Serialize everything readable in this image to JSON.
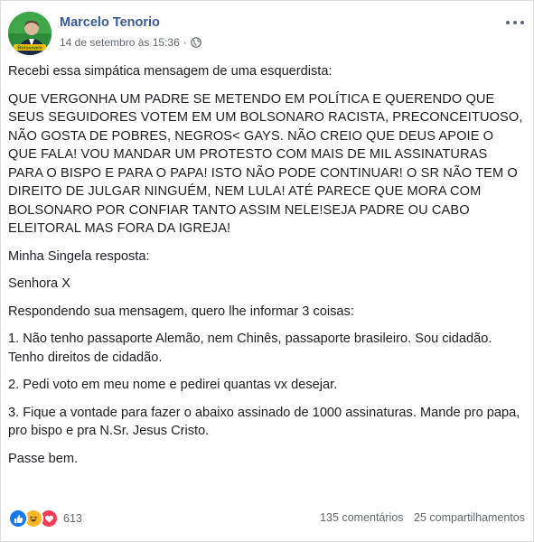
{
  "post": {
    "author": "Marcelo Tenorio",
    "timestamp": "14 de setembro às 15:36",
    "privacy_icon": "globe-icon",
    "avatar_label": "Bolsonaro",
    "menu_icon": "more-options-icon",
    "paragraphs": [
      "Recebi essa simpática mensagem de uma esquerdista:",
      "QUE VERGONHA UM PADRE SE METENDO EM POLÍTICA E QUERENDO QUE SEUS SEGUIDORES VOTEM EM UM BOLSONARO RACISTA, PRECONCEITUOSO, NÃO GOSTA DE POBRES, NEGROS< GAYS. NÃO CREIO QUE DEUS APOIE O QUE FALA! VOU MANDAR UM PROTESTO COM MAIS DE MIL ASSINATURAS PARA O BISPO E PARA O PAPA! ISTO NÃO PODE CONTINUAR! O SR NÃO TEM O DIREITO DE JULGAR NINGUÉM, NEM LULA! ATÉ PARECE QUE MORA COM BOLSONARO POR CONFIAR TANTO ASSIM NELE!SEJA PADRE OU CABO ELEITORAL MAS FORA DA IGREJA!",
      "Minha Singela resposta:",
      "Senhora X",
      "Respondendo sua mensagem, quero lhe informar 3 coisas:",
      "1. Não tenho passaporte Alemão, nem Chinês, passaporte brasileiro. Sou cidadão. Tenho direitos de cidadão.",
      "2. Pedi voto em meu nome e pedirei quantas vx desejar.",
      "3. Fique a vontade para fazer o abaixo assinado de 1000 assinaturas. Mande pro papa, pro bispo e pra N.Sr. Jesus Cristo.",
      "Passe bem."
    ]
  },
  "footer": {
    "reactions": [
      "like-icon",
      "haha-icon",
      "love-icon"
    ],
    "reaction_count": "613",
    "comments": "135 comentários",
    "shares": "25 compartilhamentos"
  },
  "colors": {
    "author_link": "#385898",
    "meta_text": "#616770",
    "like": "#1877f2",
    "haha": "#f7b928",
    "love": "#f33e58",
    "avatar_bg": "#2e8b3a"
  }
}
